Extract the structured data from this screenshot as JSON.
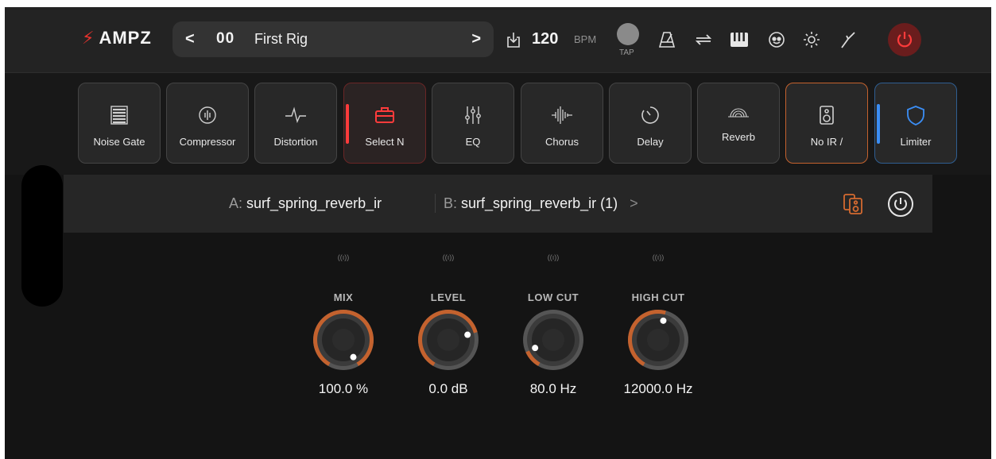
{
  "app": {
    "logo_text": "AMPZ",
    "logo_symbol": "⚡"
  },
  "rig": {
    "prev_glyph": "<",
    "number": "00",
    "name": "First Rig",
    "next_glyph": ">"
  },
  "tempo": {
    "bpm_value": "120",
    "bpm_label": "BPM",
    "tap_label": "TAP"
  },
  "toolbar_icons": [
    "save-icon",
    "metronome-icon",
    "loop-icon",
    "piano-icon",
    "mask-icon",
    "settings-icon",
    "tuner-icon",
    "power-icon"
  ],
  "effects": [
    {
      "label": "Noise Gate",
      "icon": "noise-gate-icon"
    },
    {
      "label": "Compressor",
      "icon": "compressor-icon"
    },
    {
      "label": "Distortion",
      "icon": "distortion-icon"
    },
    {
      "label": "Select N",
      "icon": "toolbox-icon",
      "state": "selected"
    },
    {
      "label": "EQ",
      "icon": "eq-sliders-icon"
    },
    {
      "label": "Chorus",
      "icon": "waveform-icon"
    },
    {
      "label": "Delay",
      "icon": "delay-icon"
    },
    {
      "label": "Reverb",
      "icon": "reverb-icon"
    },
    {
      "label": "No IR /",
      "icon": "speaker-icon",
      "state": "ir"
    },
    {
      "label": "Limiter",
      "icon": "shield-icon",
      "state": "limiter"
    }
  ],
  "ir": {
    "a_key": "A:",
    "a_name": "surf_spring_reverb_ir",
    "b_key": "B:",
    "b_name": "surf_spring_reverb_ir (1)",
    "chevron": ">"
  },
  "knobs": [
    {
      "name": "MIX",
      "value": "100.0 %",
      "mini": "((ı))",
      "fraction": 1.0
    },
    {
      "name": "LEVEL",
      "value": "0.0 dB",
      "mini": "((ı))",
      "fraction": 0.75
    },
    {
      "name": "LOW CUT",
      "value": "80.0 Hz",
      "mini": "((ı))",
      "fraction": 0.12
    },
    {
      "name": "HIGH CUT",
      "value": "12000.0 Hz",
      "mini": "((ı))",
      "fraction": 0.55
    }
  ],
  "colors": {
    "accent_red": "#e5322d",
    "knob_arc": "#c4622e",
    "limiter_blue": "#3b8ef5"
  }
}
